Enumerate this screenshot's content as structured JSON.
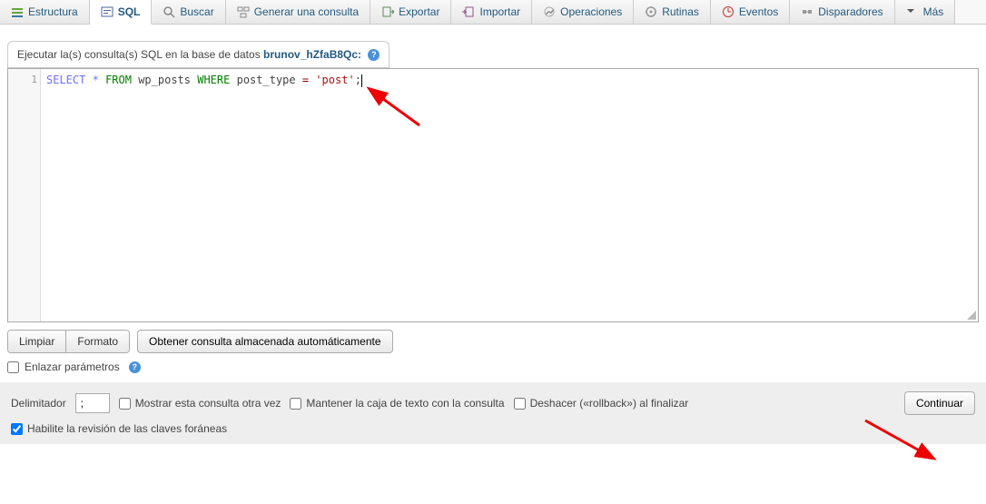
{
  "tabs": [
    {
      "label": "Estructura"
    },
    {
      "label": "SQL"
    },
    {
      "label": "Buscar"
    },
    {
      "label": "Generar una consulta"
    },
    {
      "label": "Exportar"
    },
    {
      "label": "Importar"
    },
    {
      "label": "Operaciones"
    },
    {
      "label": "Rutinas"
    },
    {
      "label": "Eventos"
    },
    {
      "label": "Disparadores"
    },
    {
      "label": "Más"
    }
  ],
  "header": {
    "prefix": "Ejecutar la(s) consulta(s) SQL en la base de datos ",
    "database": "brunov_hZfaB8Qc:"
  },
  "editor": {
    "line_number": "1",
    "tokens": {
      "select": "SELECT",
      "star": "*",
      "from": "FROM",
      "table": "wp_posts",
      "where": "WHERE",
      "col": "post_type",
      "eq": "=",
      "val": "'post'",
      "semi": ";"
    }
  },
  "buttons": {
    "clear": "Limpiar",
    "format": "Formato",
    "auto": "Obtener consulta almacenada automáticamente",
    "continue": "Continuar"
  },
  "labels": {
    "bind_params": "Enlazar parámetros",
    "delimiter": "Delimitador",
    "show_again": "Mostrar esta consulta otra vez",
    "retain_box": "Mantener la caja de texto con la consulta",
    "rollback": "Deshacer («rollback») al finalizar",
    "enable_fk": "Habilite la revisión de las claves foráneas"
  },
  "values": {
    "delimiter": ";",
    "show_again": false,
    "retain_box": false,
    "rollback": false,
    "enable_fk": true,
    "bind_params": false
  }
}
